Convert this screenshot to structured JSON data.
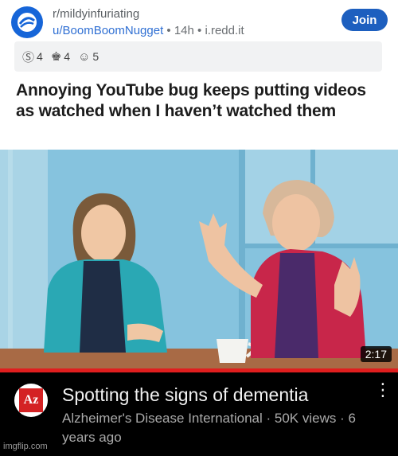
{
  "reddit": {
    "subreddit": "r/mildyinfuriating",
    "username": "u/BoomBoomNugget",
    "time": "14h",
    "domain": "i.redd.it",
    "join_label": "Join",
    "awards": [
      {
        "icon": "silver-award-icon",
        "glyph": "Ⓢ",
        "count": "4"
      },
      {
        "icon": "helpful-award-icon",
        "glyph": "♚",
        "count": "4"
      },
      {
        "icon": "wholesome-award-icon",
        "glyph": "☺",
        "count": "5"
      }
    ],
    "post_title": "Annoying YouTube bug keeps putting videos as watched when I haven’t watched them"
  },
  "video": {
    "duration": "2:17",
    "watched_progress": 1.0,
    "title": "Spotting the signs of dementia",
    "channel": "Alzheimer's Disease International",
    "views": "50K views",
    "age": "6 years ago",
    "channel_logo_text": "Az",
    "kebab": "⋮"
  },
  "watermark": "imgflip.com",
  "colors": {
    "join_button": "#1d5fbf",
    "username": "#2f6fd3",
    "progress_bar": "#e01e1e"
  }
}
